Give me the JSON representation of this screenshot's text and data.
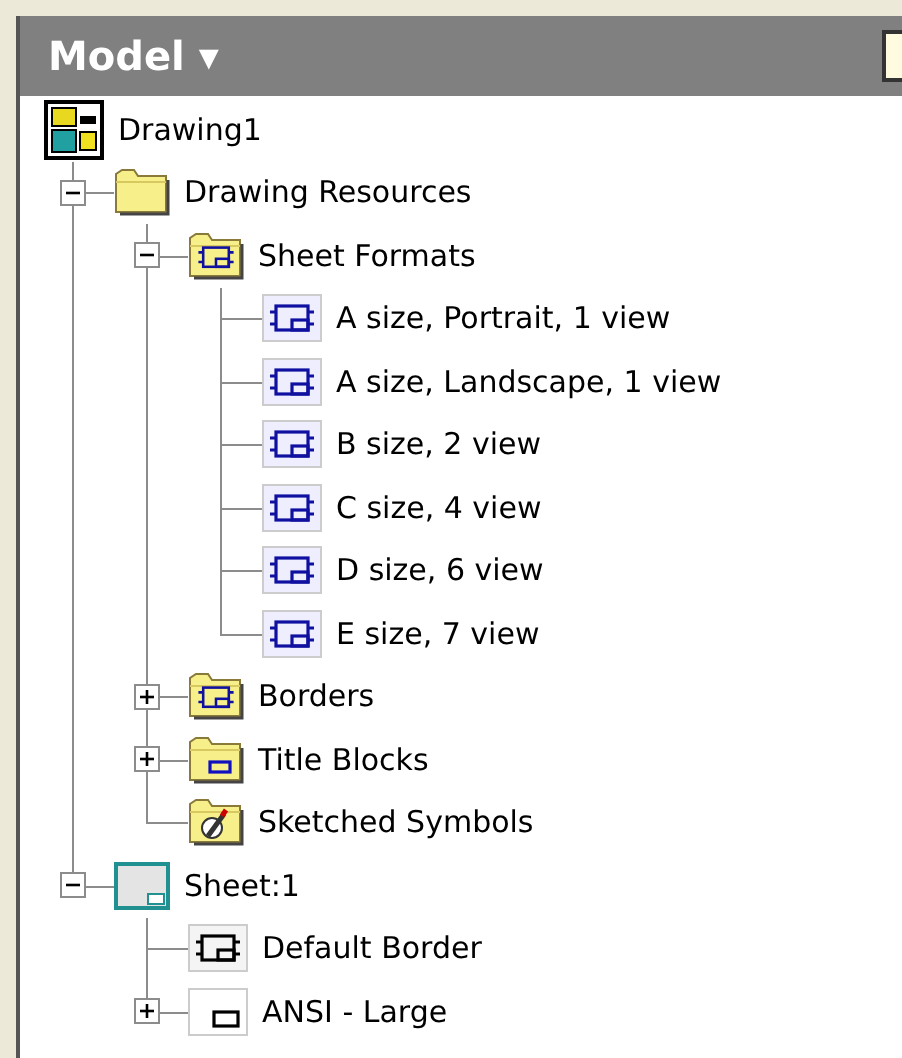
{
  "panel": {
    "title": "Model ▾"
  },
  "tree": [
    {
      "label": "Drawing1",
      "kind": "drawing",
      "children": [
        {
          "label": "Drawing Resources",
          "kind": "folder",
          "expanded": true,
          "children": [
            {
              "label": "Sheet Formats",
              "kind": "sheet_formats",
              "expanded": true,
              "children": [
                {
                  "label": "A size, Portrait, 1 view",
                  "kind": "sheet_format"
                },
                {
                  "label": "A size, Landscape, 1 view",
                  "kind": "sheet_format"
                },
                {
                  "label": "B size, 2 view",
                  "kind": "sheet_format"
                },
                {
                  "label": "C size, 4 view",
                  "kind": "sheet_format"
                },
                {
                  "label": "D size, 6 view",
                  "kind": "sheet_format"
                },
                {
                  "label": "E size, 7 view",
                  "kind": "sheet_format"
                }
              ]
            },
            {
              "label": "Borders",
              "kind": "borders",
              "expanded": false
            },
            {
              "label": "Title Blocks",
              "kind": "title_blocks",
              "expanded": false
            },
            {
              "label": "Sketched Symbols",
              "kind": "sketched_symbols"
            }
          ]
        },
        {
          "label": "Sheet:1",
          "kind": "sheet",
          "expanded": true,
          "children": [
            {
              "label": "Default Border",
              "kind": "border"
            },
            {
              "label": "ANSI - Large",
              "kind": "title_block",
              "expanded": false
            }
          ]
        }
      ]
    }
  ]
}
